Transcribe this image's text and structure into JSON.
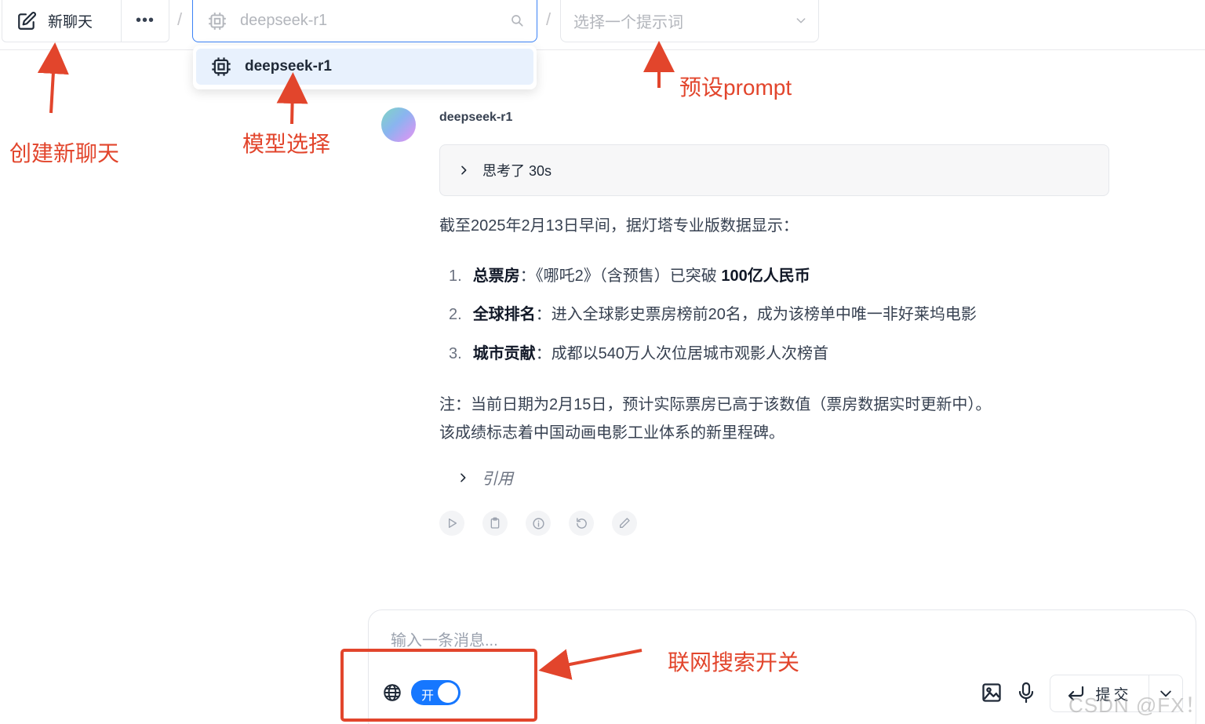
{
  "toolbar": {
    "new_chat_label": "新聊天",
    "more_label": "•••",
    "separator": "/",
    "model_value": "deepseek-r1",
    "prompt_placeholder": "选择一个提示词"
  },
  "model_dropdown": {
    "options": [
      {
        "label": "deepseek-r1",
        "selected": true
      }
    ]
  },
  "message": {
    "sender": "deepseek-r1",
    "thinking_label": "思考了 30s",
    "intro": "截至2025年2月13日早间，据灯塔专业版数据显示：",
    "items": [
      {
        "num": "1.",
        "bold": "总票房",
        "sep": "：",
        "text": "《哪吒2》（含预售）已突破 ",
        "tail_bold": "100亿人民币"
      },
      {
        "num": "2.",
        "bold": "全球排名",
        "sep": "：",
        "text": "进入全球影史票房榜前20名，成为该榜单中唯一非好莱坞电影",
        "tail_bold": ""
      },
      {
        "num": "3.",
        "bold": "城市贡献",
        "sep": "：",
        "text": "成都以540万人次位居城市观影人次榜首",
        "tail_bold": ""
      }
    ],
    "note_line1": "注：当前日期为2月15日，预计实际票房已高于该数值（票房数据实时更新中）。",
    "note_line2": "该成绩标志着中国动画电影工业体系的新里程碑。",
    "citation_label": "引用",
    "actions": [
      "play-icon",
      "clipboard-icon",
      "info-icon",
      "regenerate-icon",
      "edit-icon"
    ]
  },
  "composer": {
    "placeholder": "输入一条消息...",
    "web_search_toggle_label": "开",
    "web_search_on": true,
    "submit_label": "提交"
  },
  "annotations": {
    "new_chat": "创建新聊天",
    "model_select": "模型选择",
    "preset_prompt": "预设prompt",
    "web_search": "联网搜索开关"
  },
  "watermark": "CSDN @FX！",
  "colors": {
    "accent": "#1677ff",
    "annotation_red": "#e2452c",
    "selected_option_bg": "#e8f1fd"
  }
}
